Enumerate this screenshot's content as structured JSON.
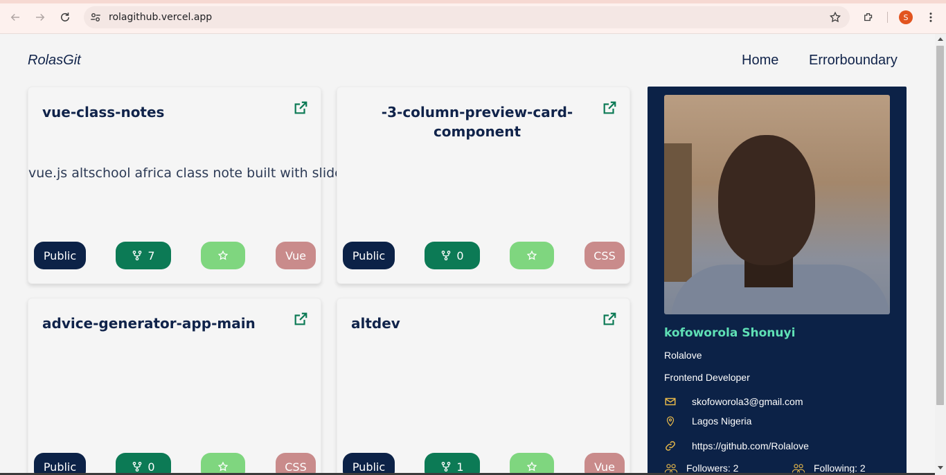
{
  "browser": {
    "url": "rolagithub.vercel.app",
    "profile_initial": "S"
  },
  "site": {
    "brand": "RolasGit",
    "nav": [
      "Home",
      "Errorboundary"
    ]
  },
  "repos": [
    {
      "name": "vue-class-notes",
      "description": "vue.js altschool africa class note built with slidev",
      "visibility": "Public",
      "forks": "7",
      "language": "Vue"
    },
    {
      "name": "-3-column-preview-card-component",
      "description": "",
      "visibility": "Public",
      "forks": "0",
      "language": "CSS"
    },
    {
      "name": "advice-generator-app-main",
      "description": "",
      "visibility": "Public",
      "forks": "0",
      "language": "CSS"
    },
    {
      "name": "altdev",
      "description": "",
      "visibility": "Public",
      "forks": "1",
      "language": "Vue"
    }
  ],
  "profile": {
    "name": "kofoworola Shonuyi",
    "login": "Rolalove",
    "bio": "Frontend Developer",
    "email": "skofoworola3@gmail.com",
    "location": "Lagos Nigeria",
    "link": "https://github.com/Rolalove",
    "followers": "Followers: 2",
    "following": "Following: 2"
  },
  "colors": {
    "navy": "#0c2247",
    "green": "#0c7a55",
    "light_green": "#7fd67f",
    "rose": "#c98b8b",
    "accent_name": "#5fe0b5",
    "icon_gold": "#e7b84a"
  }
}
